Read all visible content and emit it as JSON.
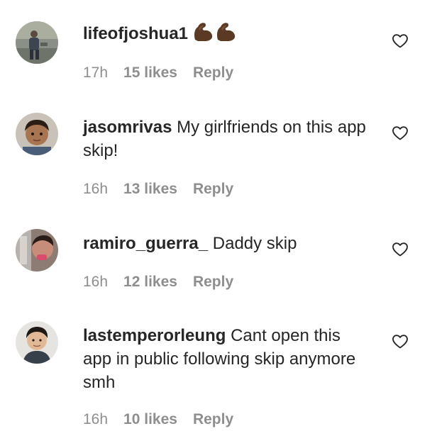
{
  "comments": [
    {
      "username": "lifeofjoshua1",
      "text": "",
      "emoji": "flexed-biceps-emoji",
      "time": "17h",
      "likes": "15 likes",
      "reply": "Reply"
    },
    {
      "username": "jasomrivas",
      "text": "My girlfriends on this app skip!",
      "time": "16h",
      "likes": "13 likes",
      "reply": "Reply"
    },
    {
      "username": "ramiro_guerra_",
      "text": "Daddy skip",
      "time": "16h",
      "likes": "12 likes",
      "reply": "Reply"
    },
    {
      "username": "lastemperorleung",
      "text": "Cant open this app in public following skip anymore smh",
      "time": "16h",
      "likes": "10 likes",
      "reply": "Reply"
    }
  ],
  "colors": {
    "text": "#262626",
    "meta": "#8e8e8e"
  },
  "icons": {
    "like": "heart-outline-icon"
  }
}
